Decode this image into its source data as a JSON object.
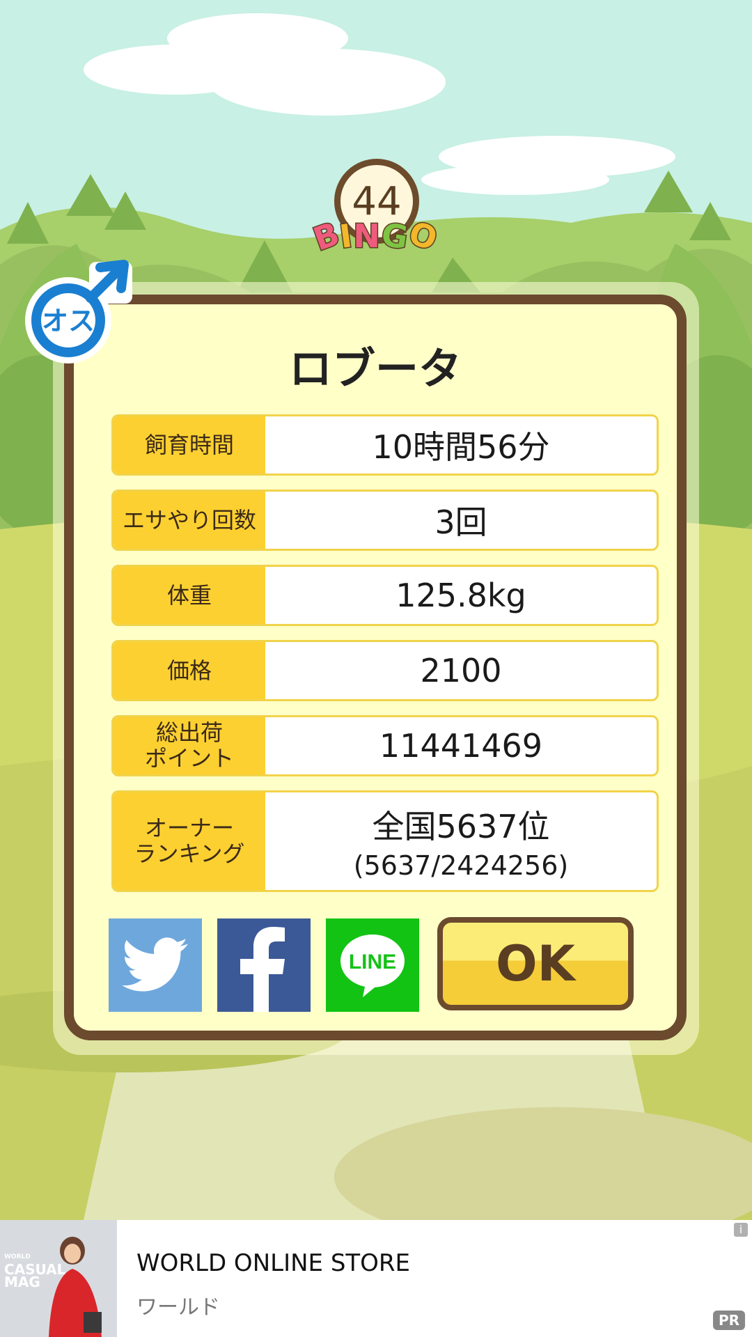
{
  "bingo": {
    "number": "44",
    "letters": [
      "B",
      "I",
      "N",
      "G",
      "O"
    ],
    "letter_colors": [
      "#ef5b7d",
      "#f2b72b",
      "#ef5b7d",
      "#7ec343",
      "#f2b72b"
    ]
  },
  "gender_badge": {
    "label": "オス",
    "icon": "male-symbol-icon",
    "color": "#1a7fd1"
  },
  "panel": {
    "title": "ロブータ",
    "rows": [
      {
        "label": "飼育時間",
        "value": "10時間56分"
      },
      {
        "label": "エサやり回数",
        "value": "3回"
      },
      {
        "label": "体重",
        "value": "125.8kg"
      },
      {
        "label": "価格",
        "value": "2100"
      },
      {
        "label": "総出荷\nポイント",
        "value": "11441469"
      },
      {
        "label": "オーナー\nランキング",
        "value": "全国5637位",
        "sub": "(5637/2424256)"
      }
    ],
    "share": {
      "twitter_icon": "twitter-bird-icon",
      "facebook_icon": "facebook-f-icon",
      "line_label": "LINE"
    },
    "ok_label": "OK"
  },
  "ad": {
    "title": "WORLD ONLINE STORE",
    "subtitle": "ワールド",
    "image_text": {
      "line1": "WORLD",
      "line2": "CASUAL",
      "line3": "MAG"
    },
    "info": "i",
    "pr": "PR"
  },
  "colors": {
    "sky": "#c8f0e4",
    "panel_bg": "#ffffc8",
    "panel_border": "#6b4a2e",
    "label_bg": "#fcd031",
    "twitter": "#6ea7dc",
    "facebook": "#3b5997",
    "line": "#12c314"
  }
}
